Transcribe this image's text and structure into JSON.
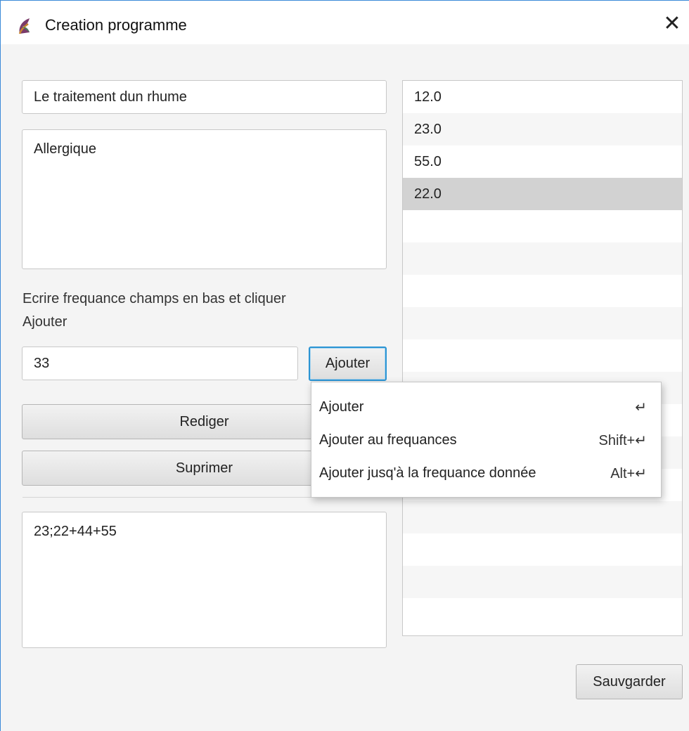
{
  "window": {
    "title": "Creation programme",
    "close_glyph": "✕"
  },
  "form": {
    "name_value": "Le traitement dun rhume",
    "description_value": "Allergique",
    "instruction_label": "Ecrire frequance champs en bas et cliquer\nAjouter",
    "frequency_value": "33",
    "add_button_label": "Ajouter",
    "edit_button_label": "Rediger",
    "delete_button_label": "Suprimer",
    "output_value": "23;22+44+55",
    "save_button_label": "Sauvgarder"
  },
  "frequency_list": {
    "items": [
      "12.0",
      "23.0",
      "55.0",
      "22.0"
    ],
    "selected_index": 3,
    "empty_rows": 13
  },
  "context_menu": {
    "items": [
      {
        "label": "Ajouter",
        "accelerator": "↵"
      },
      {
        "label": "Ajouter au frequances",
        "accelerator": "Shift+↵"
      },
      {
        "label": "Ajouter jusq'à la frequance donnée",
        "accelerator": "Alt+↵"
      }
    ]
  },
  "icons": {
    "app_icon": "feather-app-icon",
    "close_icon": "close-icon"
  },
  "colors": {
    "accent": "#2b94d3",
    "selection": "#d2d2d2",
    "window_border": "#3c8ad8"
  }
}
